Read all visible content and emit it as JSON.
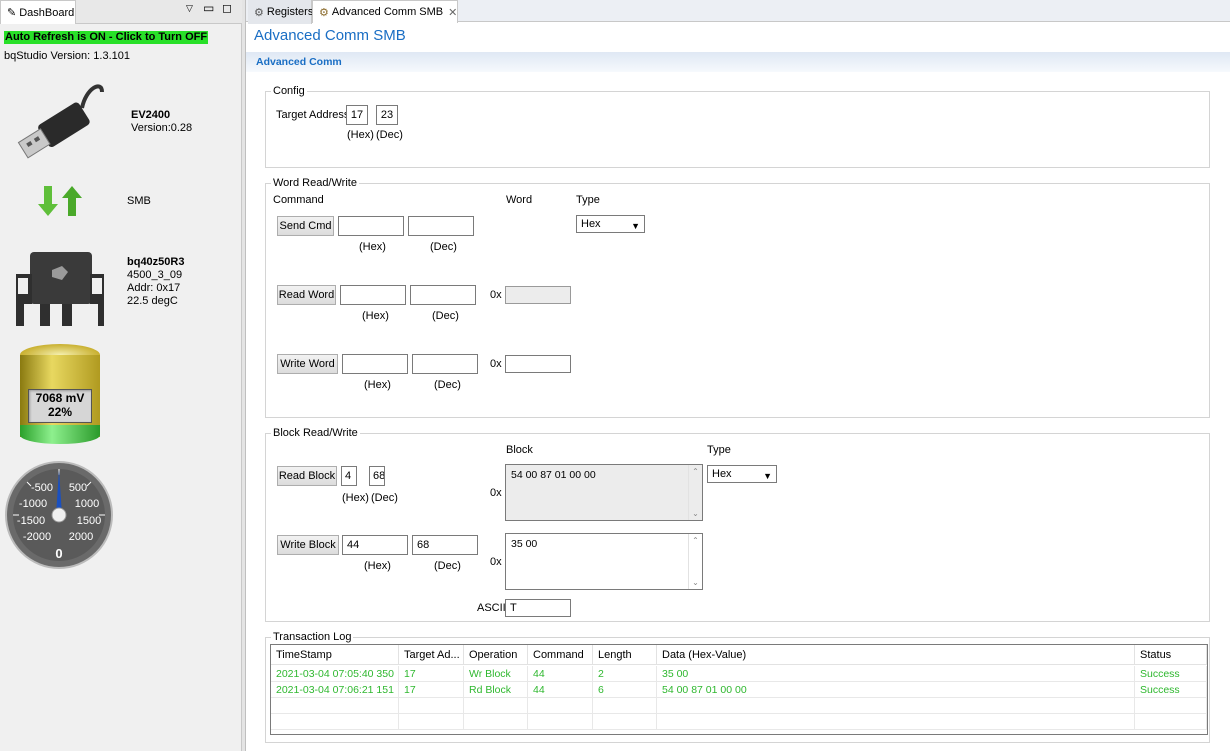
{
  "left_panel": {
    "tab_label": "DashBoard",
    "refresh_text": "Auto Refresh is ON - Click to Turn OFF",
    "version_text": "bqStudio Version:  1.3.101",
    "adapter": {
      "name": "EV2400",
      "version": "Version:0.28"
    },
    "bus": "SMB",
    "device": {
      "name": "bq40z50R3",
      "fw": "4500_3_09",
      "addr": "Addr: 0x17",
      "temp": "22.5 degC"
    },
    "battery": {
      "voltage": "7068 mV",
      "soc": "22%",
      "soc_fraction": 0.22
    },
    "gauge": {
      "labels": [
        "-500",
        "500",
        "-1000",
        "1000",
        "-1500",
        "1500",
        "-2000",
        "2000"
      ],
      "value": "0"
    }
  },
  "tabs": [
    {
      "label": "Registers",
      "icon": "gear-icon"
    },
    {
      "label": "Advanced Comm SMB",
      "icon": "chip-icon"
    }
  ],
  "page_title": "Advanced Comm SMB",
  "section_title": "Advanced Comm",
  "config": {
    "group": "Config",
    "target_label": "Target Address",
    "hex": "17",
    "dec": "23",
    "hex_label": "(Hex)",
    "dec_label": "(Dec)"
  },
  "word": {
    "group": "Word Read/Write",
    "command_label": "Command",
    "word_label": "Word",
    "type_label": "Type",
    "type_value": "Hex",
    "send_cmd": "Send Cmd",
    "read_word": "Read Word",
    "write_word": "Write Word",
    "hex_label": "(Hex)",
    "dec_label": "(Dec)",
    "ox": "0x"
  },
  "block": {
    "group": "Block Read/Write",
    "block_label": "Block",
    "type_label": "Type",
    "type_value": "Hex",
    "read_block": "Read Block",
    "write_block": "Write Block",
    "read_hex": "4",
    "read_dec": "68",
    "write_hex": "44",
    "write_dec": "68",
    "read_data": "54 00 87 01 00 00",
    "write_data": "35 00",
    "hex_label": "(Hex)",
    "dec_label": "(Dec)",
    "ox": "0x",
    "ascii_label": "ASCII",
    "ascii_value": "T"
  },
  "log": {
    "group": "Transaction Log",
    "columns": [
      "TimeStamp",
      "Target Ad...",
      "Operation",
      "Command",
      "Length",
      "Data (Hex-Value)",
      "Status"
    ],
    "rows": [
      [
        "2021-03-04 07:05:40 350",
        "17",
        "Wr Block",
        "44",
        "2",
        "35 00",
        "Success"
      ],
      [
        "2021-03-04 07:06:21 151",
        "17",
        "Rd Block",
        "44",
        "6",
        "54 00 87 01 00 00",
        "Success"
      ]
    ]
  },
  "colors": {
    "accent": "#1a6ec4",
    "refresh_bg": "#28e028",
    "log_text": "#2fb82f"
  }
}
